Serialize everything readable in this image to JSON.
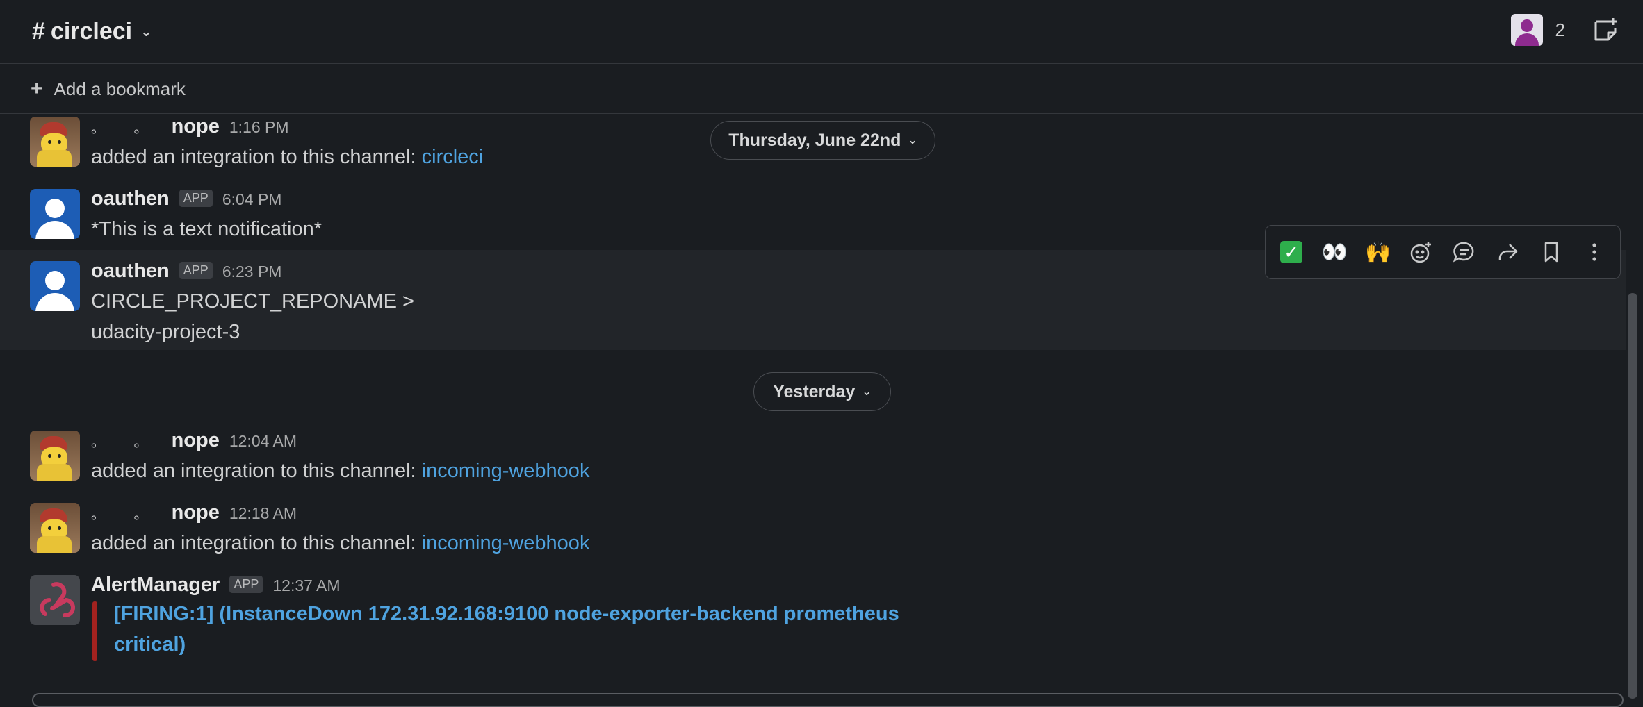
{
  "header": {
    "channel_hash": "#",
    "channel_name": "circleci",
    "member_count": "2",
    "member_icon": "user-avatar-icon",
    "canvas_icon": "canvas-icon"
  },
  "bookmark": {
    "label": "Add a bookmark"
  },
  "date_dividers": [
    {
      "label": "Thursday, June 22nd"
    },
    {
      "label": "Yesterday"
    }
  ],
  "messages": [
    {
      "prefix": "。 。",
      "author": "nope",
      "time": "1:16 PM",
      "text": "added an integration to this channel: ",
      "link": "circleci"
    },
    {
      "author": "oauthen",
      "badge": "APP",
      "time": "6:04 PM",
      "text": "*This is a text notification*"
    },
    {
      "author": "oauthen",
      "badge": "APP",
      "time": "6:23 PM",
      "line1": "CIRCLE_PROJECT_REPONAME  >",
      "line2": "udacity-project-3"
    },
    {
      "prefix": "。 。",
      "author": "nope",
      "time": "12:04 AM",
      "text": "added an integration to this channel: ",
      "link": "incoming-webhook"
    },
    {
      "prefix": "。 。",
      "author": "nope",
      "time": "12:18 AM",
      "text": "added an integration to this channel: ",
      "link": "incoming-webhook"
    },
    {
      "author": "AlertManager",
      "badge": "APP",
      "time": "12:37 AM",
      "attachment_line1": "[FIRING:1]  (InstanceDown 172.31.92.168:9100 node-exporter-backend prometheus",
      "attachment_line2": "critical)",
      "attachment_color": "#a3221f"
    }
  ],
  "toolbar": {
    "reactions": [
      "✅",
      "👀",
      "🙌"
    ],
    "actions": [
      "add-reaction-icon",
      "reply-in-thread-icon",
      "share-icon",
      "bookmark-icon",
      "more-actions-icon"
    ]
  },
  "colors": {
    "background": "#1a1d21",
    "link": "#4fa3e0",
    "hover_row": "#222529"
  }
}
